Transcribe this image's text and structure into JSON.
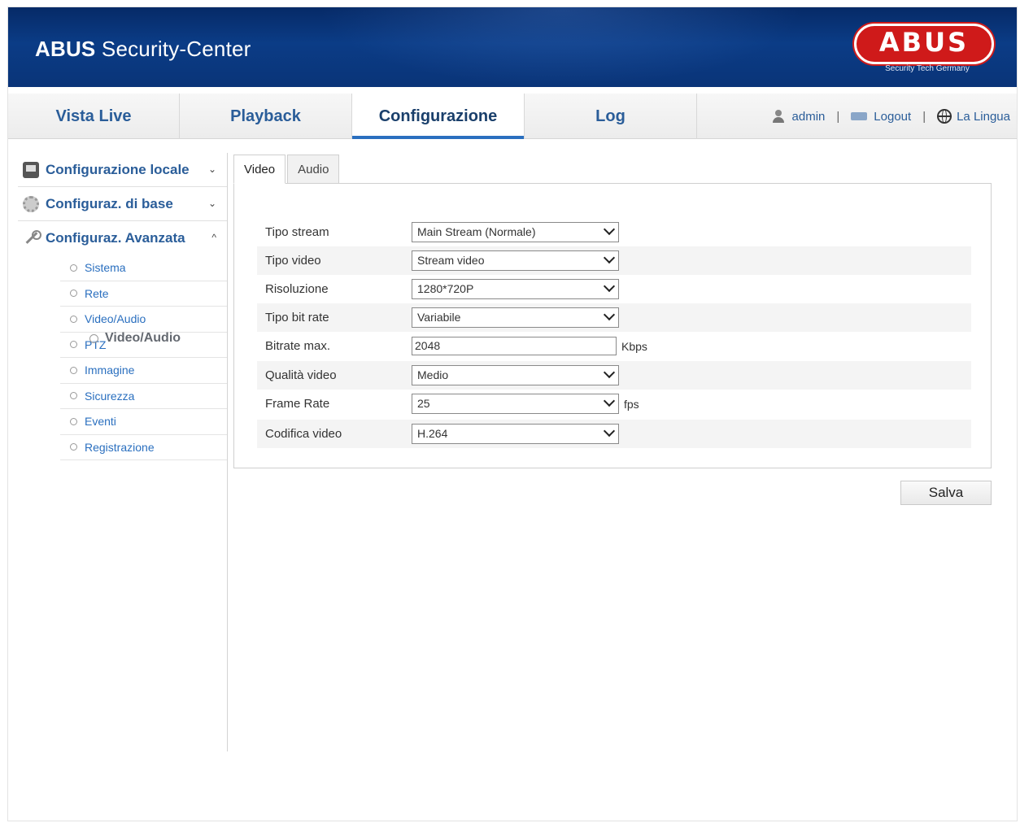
{
  "header": {
    "title_bold": "ABUS",
    "title_rest": " Security-Center",
    "logo_text": "ABUS",
    "logo_sub": "Security Tech Germany"
  },
  "nav": {
    "tabs": [
      {
        "label": "Vista Live"
      },
      {
        "label": "Playback"
      },
      {
        "label": "Configurazione"
      },
      {
        "label": "Log"
      }
    ],
    "active_tab": "Configurazione",
    "user": "admin",
    "logout": "Logout",
    "language": "La Lingua",
    "separator": "|"
  },
  "sidebar": {
    "sections": [
      {
        "label": "Configurazione locale",
        "chevron": "⌄",
        "icon": "screen-icon"
      },
      {
        "label": "Configuraz. di base",
        "chevron": "⌄",
        "icon": "gear-icon"
      },
      {
        "label": "Configuraz. Avanzata",
        "chevron": "^",
        "icon": "wrench-icon"
      }
    ],
    "items": [
      {
        "label": "Sistema"
      },
      {
        "label": "Rete"
      },
      {
        "label": "Video/Audio"
      },
      {
        "label": "PTZ"
      },
      {
        "label": "Immagine"
      },
      {
        "label": "Sicurezza"
      },
      {
        "label": "Eventi"
      },
      {
        "label": "Registrazione"
      }
    ],
    "drag_ghost": "Video/Audio"
  },
  "content": {
    "tabs": [
      {
        "label": "Video"
      },
      {
        "label": "Audio"
      }
    ],
    "active_tab": "Video",
    "fields": {
      "tipo_stream": {
        "label": "Tipo stream",
        "value": "Main Stream (Normale)"
      },
      "tipo_video": {
        "label": "Tipo video",
        "value": "Stream video"
      },
      "risoluzione": {
        "label": "Risoluzione",
        "value": "1280*720P"
      },
      "tipo_bit_rate": {
        "label": "Tipo bit rate",
        "value": "Variabile"
      },
      "bitrate_max": {
        "label": "Bitrate max.",
        "value": "2048",
        "unit": "Kbps"
      },
      "qualita_video": {
        "label": "Qualità video",
        "value": "Medio"
      },
      "frame_rate": {
        "label": "Frame Rate",
        "value": "25",
        "unit": "fps"
      },
      "codifica_video": {
        "label": "Codifica video",
        "value": "H.264"
      }
    },
    "save_label": "Salva"
  },
  "colors": {
    "header_bg": "#0a3478",
    "link_blue": "#2a5d99",
    "logo_red": "#cf1a1a",
    "active_underline": "#2a6fbf"
  }
}
